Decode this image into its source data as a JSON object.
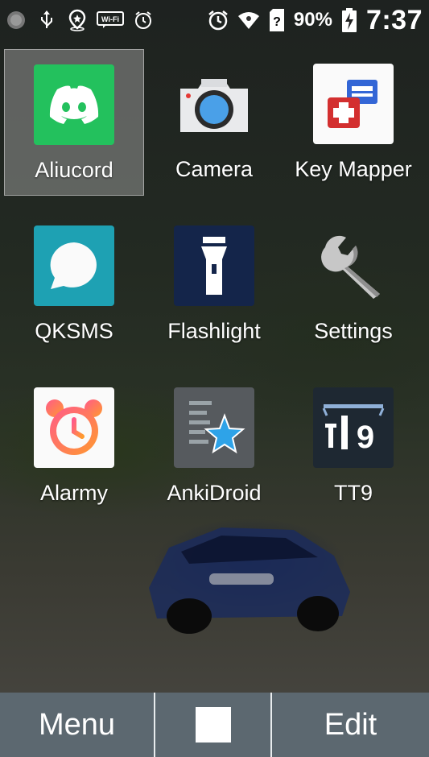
{
  "status_bar": {
    "battery_percent": "90%",
    "time": "7:37",
    "icons": [
      "notification-dot-icon",
      "usb-icon",
      "location-icon",
      "wifi-label-icon",
      "alarm-icon",
      "alarm-clock-icon",
      "wifi-signal-icon",
      "sim-unknown-icon",
      "battery-charging-icon"
    ],
    "wifi_label": "Wi-Fi"
  },
  "apps": [
    {
      "label": "Aliucord",
      "icon": "discord-icon",
      "selected": true
    },
    {
      "label": "Camera",
      "icon": "camera-icon"
    },
    {
      "label": "Key Mapper",
      "icon": "key-mapper-icon"
    },
    {
      "label": "QKSMS",
      "icon": "chat-bubble-icon"
    },
    {
      "label": "Flashlight",
      "icon": "flashlight-icon"
    },
    {
      "label": "Settings",
      "icon": "wrench-icon"
    },
    {
      "label": "Alarmy",
      "icon": "alarm-clock-icon"
    },
    {
      "label": "AnkiDroid",
      "icon": "anki-star-icon"
    },
    {
      "label": "TT9",
      "icon": "tt9-icon"
    }
  ],
  "bottom_bar": {
    "left_label": "Menu",
    "center_icon": "square-icon",
    "right_label": "Edit"
  },
  "colors": {
    "discord_green": "#23c15d",
    "qksms_teal": "#1ea1b3",
    "flashlight_navy": "#14254a",
    "bottom_bar": "#5c6870"
  }
}
